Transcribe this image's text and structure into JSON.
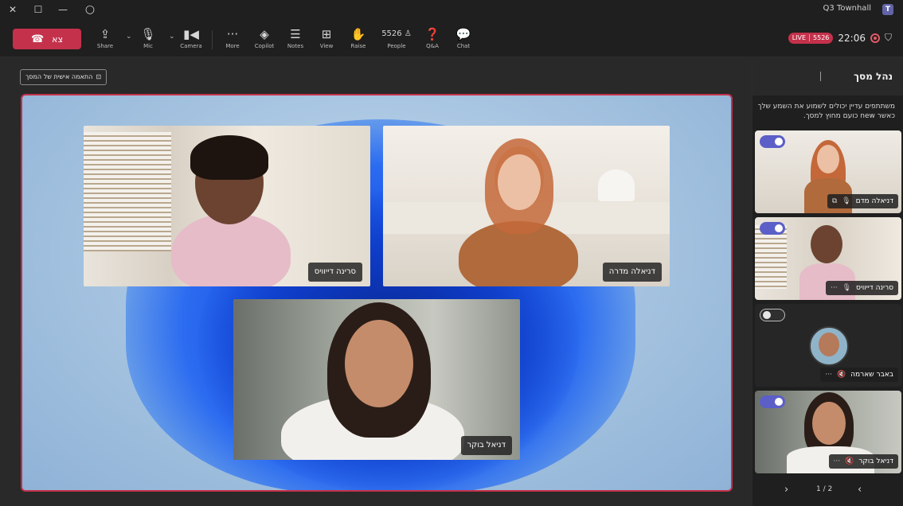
{
  "window": {
    "title": "Q3 Townhall",
    "app_icon": "T",
    "controls": {
      "close": "✕",
      "maximize": "☐",
      "minimize": "—",
      "circle": "○"
    }
  },
  "toolbar": {
    "leave_label": "צא",
    "share": "Share",
    "mic": "Mic",
    "camera": "Camera",
    "more": "More",
    "copilot": "Copilot",
    "notes": "Notes",
    "view": "View",
    "raise": "Raise",
    "people": "People",
    "people_count": "5526",
    "qa": "Q&A",
    "chat": "Chat",
    "time": "22:06",
    "live_label": "LIVE",
    "live_count": "5526"
  },
  "stage": {
    "custom_layout_label": "התאמה אישית של המסך",
    "tiles": [
      {
        "name": "סרינה דייוויס"
      },
      {
        "name": "דניאלה מדרה"
      },
      {
        "name": "דניאל בוקר"
      }
    ]
  },
  "panel": {
    "title": "נהל מסך",
    "description": "משתתפים עדיין יכולים לשמוע את השמע שלך כאשר new כועם מחוץ למסך.",
    "participants": [
      {
        "name": "דניאלה מדם",
        "toggle": "on"
      },
      {
        "name": "סרינה דייוויס",
        "toggle": "on"
      },
      {
        "name": "באבר שארמה",
        "toggle": "off"
      },
      {
        "name": "דניאל בוקר",
        "toggle": "on"
      }
    ],
    "pager": {
      "label": "1 / 2",
      "prev": "‹",
      "next": "›"
    }
  },
  "colors": {
    "accent": "#5b5fc7",
    "danger": "#c4314b",
    "background": "#1f1f1f"
  }
}
